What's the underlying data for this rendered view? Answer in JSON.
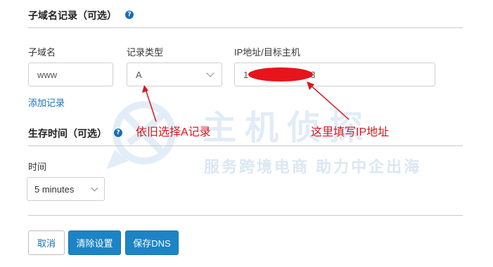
{
  "subdomain_section": {
    "title": "子域名记录（可选）",
    "help_glyph": "?",
    "subdomain_label": "子域名",
    "subdomain_value": "www",
    "record_type_label": "记录类型",
    "record_type_value": "A",
    "target_label": "IP地址/目标主机",
    "target_value_start": "1",
    "target_value_end": "3",
    "add_record_link": "添加记录"
  },
  "ttl_section": {
    "title": "生存时间（可选）",
    "help_glyph": "?",
    "time_label": "时间",
    "time_value": "5 minutes"
  },
  "buttons": {
    "cancel": "取消",
    "clear": "清除设置",
    "save": "保存DNS"
  },
  "annotations": {
    "select_a": "依旧选择A记录",
    "fill_ip": "这里填写IP地址",
    "color": "#d9161d"
  },
  "watermark": {
    "brand": "主机侦探",
    "slogan": "服务跨境电商 助力中企出海"
  },
  "colors": {
    "primary": "#1c84c6",
    "link": "#1a6fb5",
    "redaction": "#e8141c"
  }
}
